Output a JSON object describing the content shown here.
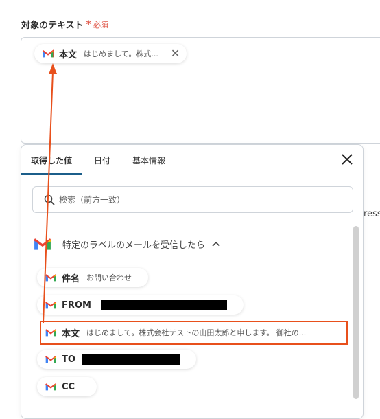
{
  "field": {
    "label": "対象のテキスト",
    "required_star": "*",
    "required_text": "必須"
  },
  "top_chip": {
    "key": "本文",
    "value": "はじめまして。株式...",
    "icon": "gmail-icon",
    "close": "✕"
  },
  "tabs": [
    {
      "label": "取得した値",
      "active": true
    },
    {
      "label": "日付",
      "active": false
    },
    {
      "label": "基本情報",
      "active": false
    }
  ],
  "search": {
    "placeholder": "検索（前方一致）"
  },
  "section": {
    "title": "特定のラベルのメールを受信したら",
    "caret": "^"
  },
  "items": [
    {
      "key": "件名",
      "value": "お問い合わせ"
    },
    {
      "key": "FROM",
      "value": "",
      "redacted": true
    },
    {
      "key": "本文",
      "value": "はじめまして。株式会社テストの山田太郎と申します。 御社の..."
    },
    {
      "key": "TO",
      "value": "",
      "redacted": true
    },
    {
      "key": "CC",
      "value": ""
    }
  ],
  "right_fragment": "ress",
  "colors": {
    "accent": "#1b5e8a",
    "required": "#e0584a",
    "annotation": "#e8501c"
  }
}
